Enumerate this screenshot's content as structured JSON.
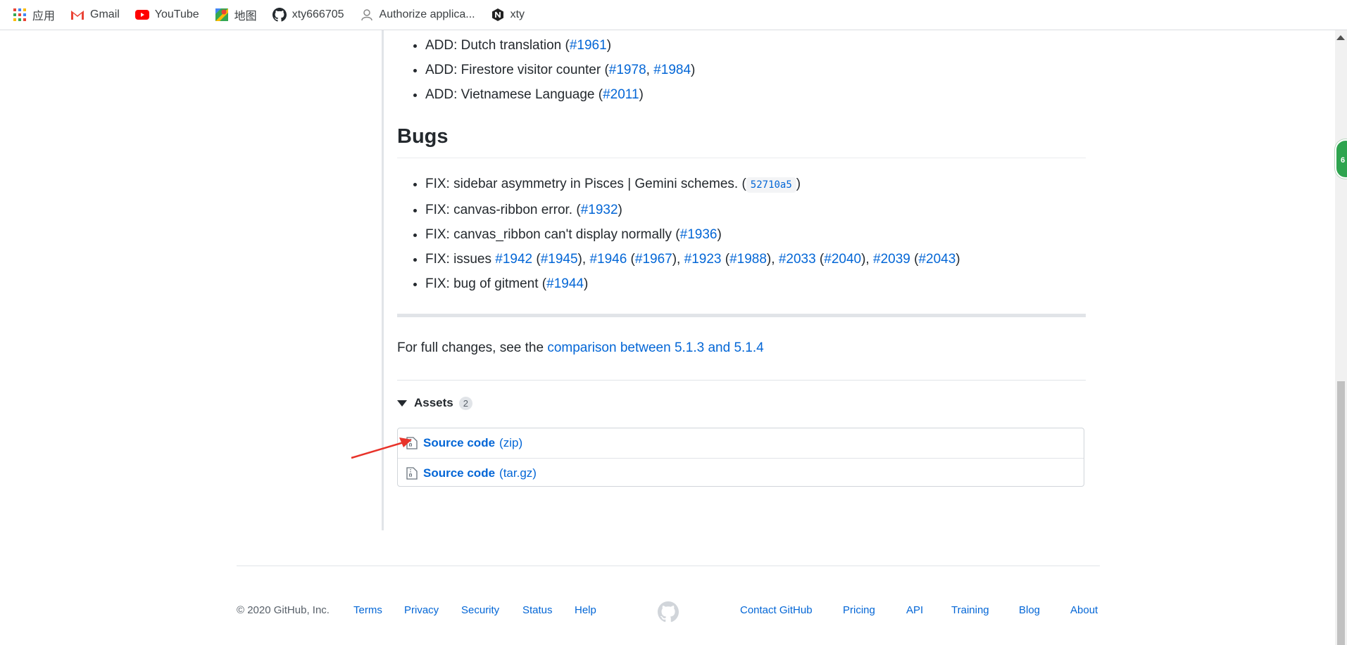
{
  "bookmarks": [
    {
      "label": "应用",
      "icon": "apps-grid-icon"
    },
    {
      "label": "Gmail",
      "icon": "gmail-icon"
    },
    {
      "label": "YouTube",
      "icon": "youtube-icon"
    },
    {
      "label": "地图",
      "icon": "maps-icon"
    },
    {
      "label": "xty666705",
      "icon": "github-icon"
    },
    {
      "label": "Authorize applica...",
      "icon": "authorize-icon"
    },
    {
      "label": "xty",
      "icon": "n-logo-icon"
    }
  ],
  "features": [
    {
      "prefix": "ADD: Dutch translation (",
      "links": [
        "#1961"
      ],
      "suffix": ")"
    },
    {
      "prefix": "ADD: Firestore visitor counter (",
      "links": [
        "#1978",
        "#1984"
      ],
      "suffix": ")"
    },
    {
      "prefix": "ADD: Vietnamese Language (",
      "links": [
        "#2011"
      ],
      "suffix": ")"
    }
  ],
  "bugs_heading": "Bugs",
  "bugs": {
    "item1_prefix": "FIX: sidebar asymmetry in Pisces | Gemini schemes. (",
    "item1_sha": "52710a5",
    "item1_suffix": ")",
    "item2_prefix": "FIX: canvas-ribbon error. (",
    "item2_link": "#1932",
    "item3_prefix": "FIX: canvas_ribbon can't display normally (",
    "item3_link": "#1936",
    "item4_prefix": "FIX: issues ",
    "item4_links": [
      "#1942",
      "#1945",
      "#1946",
      "#1967",
      "#1923",
      "#1988",
      "#2033",
      "#2040",
      "#2039",
      "#2043"
    ],
    "item5_prefix": "FIX: bug of gitment (",
    "item5_link": "#1944",
    "close": ")"
  },
  "full_changes": {
    "prefix": "For full changes, see the ",
    "link": "comparison between 5.1.3 and 5.1.4"
  },
  "assets": {
    "title": "Assets",
    "count": "2",
    "items": [
      {
        "label": "Source code",
        "ext": "(zip)",
        "icon": "zip-file-icon"
      },
      {
        "label": "Source code",
        "ext": "(tar.gz)",
        "icon": "zip-file-icon"
      }
    ]
  },
  "footer": {
    "copyright": "© 2020 GitHub, Inc.",
    "left_links": [
      "Terms",
      "Privacy",
      "Security",
      "Status",
      "Help"
    ],
    "right_links": [
      "Contact GitHub",
      "Pricing",
      "API",
      "Training",
      "Blog",
      "About"
    ]
  },
  "extension_badge": "6"
}
